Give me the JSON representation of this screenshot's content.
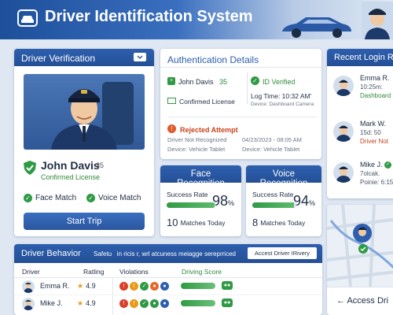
{
  "header": {
    "title": "Driver Identification System"
  },
  "driver_verification": {
    "title": "Driver Verification",
    "driver_name": "John Davis",
    "driver_id": "35",
    "license_status": "Confirmed License",
    "checks": [
      {
        "label": "Face Match"
      },
      {
        "label": "Voice Match"
      }
    ],
    "start_button": "Start Trip"
  },
  "authentication": {
    "title": "Authentication Details",
    "driver_name": "John Davis",
    "driver_id": "35",
    "license": "Confirmed License",
    "status": "ID Verified",
    "log_time": "Log Time: 10:32 AM'",
    "device": "Device: Dashboard Camera",
    "rejected": {
      "title": "Rejected Attempt",
      "reason": "Driver Not Recognized",
      "timestamp": "04/23/2023 - 08:05 AM",
      "device_left": "Device: Vehicle Tablet",
      "device_right": "Device: Vehicle Tablet"
    }
  },
  "face_recognition": {
    "title": "Face Recognition",
    "success_label": "Success Rate",
    "rate": "98",
    "rate_unit": "%",
    "rate_value": 98,
    "matches_count": "10",
    "matches_label": "Matches Today"
  },
  "voice_recognition": {
    "title": "Voice Recognition",
    "success_label": "Success Rate",
    "rate": "94",
    "rate_unit": "%",
    "rate_value": 94,
    "matches_count": "8",
    "matches_label": "Matches Today"
  },
  "recent_logins": {
    "title": "Recent Login R",
    "items": [
      {
        "name": "Emma R.",
        "time": "10:25m:",
        "status": "Dashboard"
      },
      {
        "name": "Mark W.",
        "time": "15d: 50",
        "status": "Driver Not"
      },
      {
        "name": "Mike J.",
        "time": "7olcak.",
        "status": "Poinie: 6:15"
      }
    ]
  },
  "map": {
    "access_label": "← Access Dri"
  },
  "driver_behavior": {
    "title": "Driver Behavior",
    "safety_text": "Safetu   in ricis r, wrl atcuness meiagge sereprriced",
    "access_button": "Accest Driver IRivery",
    "columns": {
      "driver": "Driver",
      "rating": "Ratling",
      "violations": "Violations",
      "score": "Driving Score"
    },
    "rows": [
      {
        "name": "Emma R.",
        "rating": "4.9"
      },
      {
        "name": "Mike J.",
        "rating": "4.9"
      }
    ]
  },
  "colors": {
    "primary": "#2d5fae",
    "success": "#2f9a44",
    "danger": "#e05a2a",
    "background": "#dfe7f2"
  }
}
